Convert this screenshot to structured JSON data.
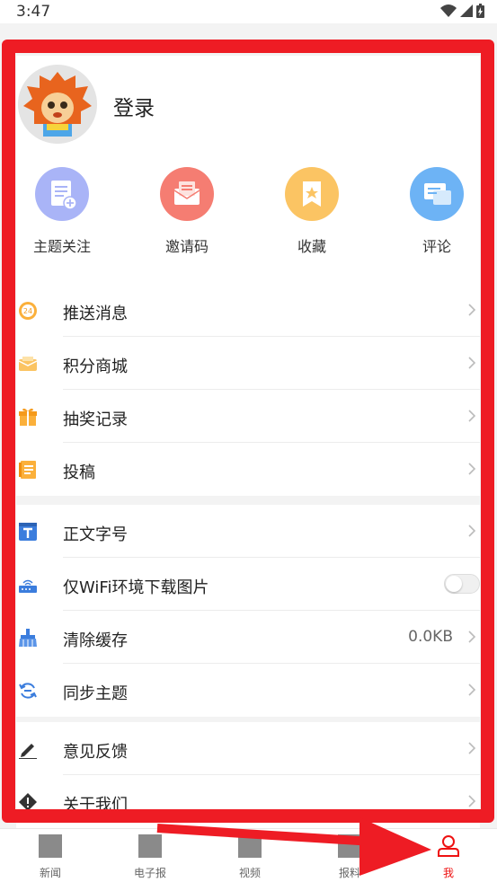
{
  "status_bar": {
    "time": "3:47"
  },
  "profile": {
    "login_label": "登录"
  },
  "quick_actions": [
    {
      "label": "主题关注",
      "icon": "topic-follow-icon",
      "color": "#a9b4f7"
    },
    {
      "label": "邀请码",
      "icon": "invite-mail-icon",
      "color": "#f57d72"
    },
    {
      "label": "收藏",
      "icon": "bookmark-star-icon",
      "color": "#fbc463"
    },
    {
      "label": "评论",
      "icon": "comment-icon",
      "color": "#6db3f5"
    }
  ],
  "menu_group_1": [
    {
      "label": "推送消息",
      "icon": "push-24-icon"
    },
    {
      "label": "积分商城",
      "icon": "points-mall-icon"
    },
    {
      "label": "抽奖记录",
      "icon": "gift-icon"
    },
    {
      "label": "投稿",
      "icon": "document-icon"
    }
  ],
  "menu_group_2": [
    {
      "label": "正文字号",
      "icon": "font-size-icon"
    },
    {
      "label": "仅WiFi环境下载图片",
      "icon": "wifi-router-icon",
      "toggle_on": false
    },
    {
      "label": "清除缓存",
      "icon": "broom-icon",
      "value": "0.0KB"
    },
    {
      "label": "同步主题",
      "icon": "sync-icon"
    }
  ],
  "menu_group_3": [
    {
      "label": "意见反馈",
      "icon": "pencil-icon"
    },
    {
      "label": "关于我们",
      "icon": "info-diamond-icon"
    }
  ],
  "tabbar": {
    "tabs": [
      {
        "label": "新闻"
      },
      {
        "label": "电子报"
      },
      {
        "label": "视频"
      },
      {
        "label": "报料"
      },
      {
        "label": "我",
        "active": true
      }
    ]
  },
  "colors": {
    "accent": "#ee1c24",
    "active_tab": "#e11111"
  }
}
